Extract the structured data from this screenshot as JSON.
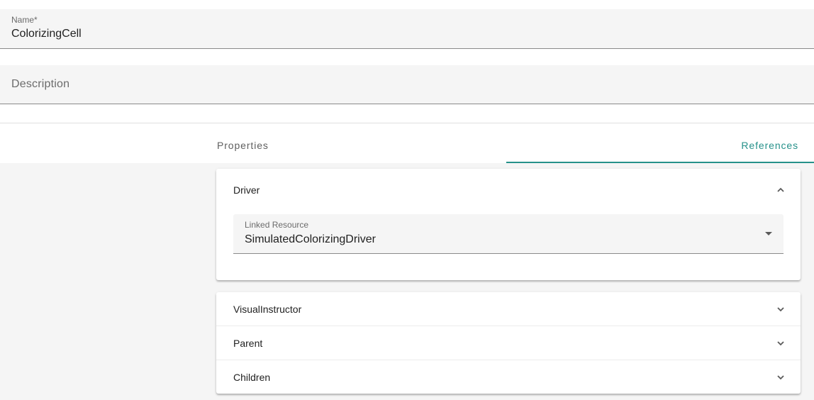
{
  "form": {
    "name_label": "Name*",
    "name_value": "ColorizingCell",
    "description_placeholder": "Description"
  },
  "tabs": [
    {
      "label": "Properties",
      "active": false
    },
    {
      "label": "References",
      "active": true
    }
  ],
  "accent_color": "#26918a",
  "icons": {
    "expanded": "chevron-up-icon",
    "collapsed": "chevron-down-icon",
    "select": "dropdown-arrow-icon"
  },
  "references": {
    "driver": {
      "title": "Driver",
      "expanded": true,
      "field_label": "Linked Resource",
      "field_value": "SimulatedColorizingDriver"
    },
    "collapsed_panels": [
      {
        "title": "VisualInstructor",
        "expanded": false
      },
      {
        "title": "Parent",
        "expanded": false
      },
      {
        "title": "Children",
        "expanded": false
      }
    ]
  }
}
